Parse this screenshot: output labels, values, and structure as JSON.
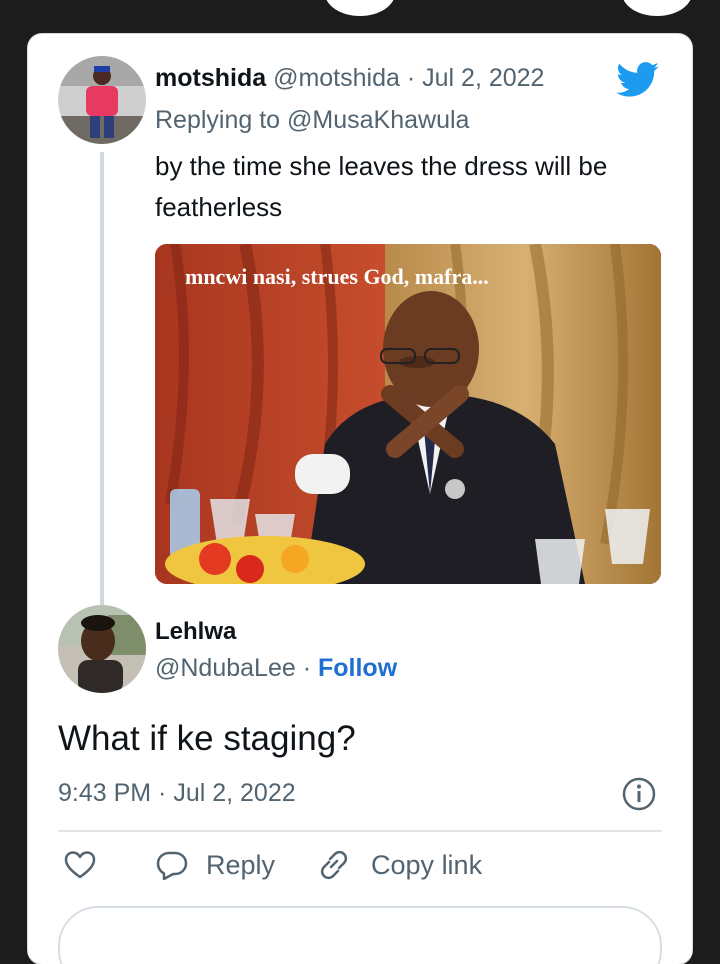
{
  "tweet": {
    "author_name": "motshida",
    "author_handle": "@motshida",
    "separator": "·",
    "date": "Jul 2, 2022",
    "replying_prefix": "Replying to",
    "replying_to": "@MusaKhawula",
    "text": "by the time she leaves the dress will be featherless",
    "media_caption": "mncwi nasi, strues God, mafra...",
    "brand_icon": "twitter-bird-icon",
    "brand_color": "#1d9bf0"
  },
  "main_tweet": {
    "author_name": "Lehlwa",
    "author_handle": "@NdubaLee",
    "separator": "·",
    "follow_label": "Follow",
    "text": "What if ke staging?",
    "timestamp": "9:43 PM · Jul 2, 2022",
    "info_icon": "info-icon"
  },
  "actions": {
    "like_icon": "heart-icon",
    "reply_label": "Reply",
    "copy_link_label": "Copy link"
  },
  "colors": {
    "link": "#1d6fd1",
    "muted": "#536471",
    "background": "#1c1c1c"
  }
}
